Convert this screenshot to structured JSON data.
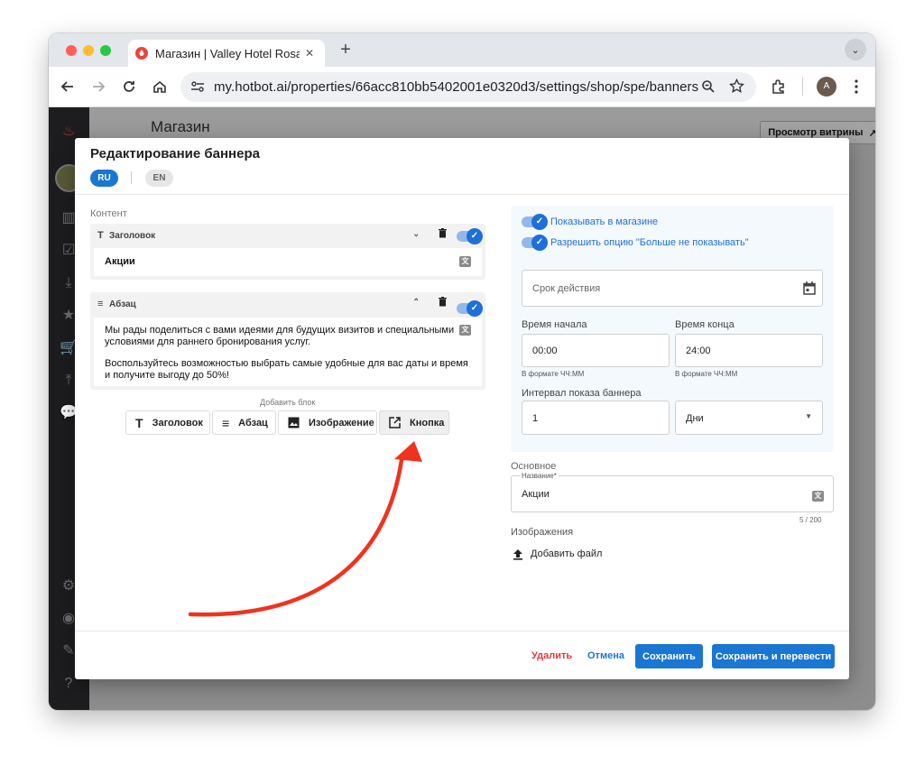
{
  "browser": {
    "tab_title": "Магазин | Valley Hotel Rosa K",
    "url_host": "my.hotbot.ai",
    "url_path": "/properties/66acc810bb5402001e0320d3/settings/shop/spe/banners",
    "avatar_initials": "A"
  },
  "app": {
    "page_title": "Магазин",
    "preview_button": "Просмотр витрины"
  },
  "modal": {
    "title": "Редактирование баннера",
    "languages": [
      "RU",
      "EN"
    ],
    "content_label": "Контент",
    "blocks": [
      {
        "type_label": "Заголовок",
        "text": "Акции",
        "enabled": true,
        "expanded": false
      },
      {
        "type_label": "Абзац",
        "lines": [
          "Мы рады поделиться с вами идеями для будущих визитов и специальными",
          "условиями для раннего бронирования услуг.",
          "",
          "Воспользуйтесь возможностью выбрать самые удобные для вас даты и время",
          "и получите выгоду до 50%!"
        ],
        "enabled": true,
        "expanded": true
      }
    ],
    "add_block_label": "Добавить блок",
    "add_buttons": [
      "Заголовок",
      "Абзац",
      "Изображение",
      "Кнопка"
    ],
    "settings": {
      "show_in_shop": "Показывать в магазине",
      "allow_dont_show": "Разрешить опцию \"Больше не показывать\"",
      "validity_placeholder": "Срок действия",
      "start_label": "Время начала",
      "start_value": "00:00",
      "end_label": "Время конца",
      "end_value": "24:00",
      "time_hint": "В формате ЧЧ:ММ",
      "interval_label": "Интервал показа баннера",
      "interval_value": "1",
      "interval_unit": "Дни"
    },
    "basic": {
      "section_label": "Основное",
      "name_label": "Название*",
      "name_value": "Акции",
      "name_counter": "5 / 200",
      "images_label": "Изображения",
      "add_file": "Добавить файл"
    },
    "footer": {
      "delete": "Удалить",
      "cancel": "Отмена",
      "save": "Сохранить",
      "save_translate": "Сохранить и перевести"
    }
  },
  "colors": {
    "accent": "#1976d2",
    "danger": "#e53935",
    "annotation_arrow": "#f0321e"
  }
}
